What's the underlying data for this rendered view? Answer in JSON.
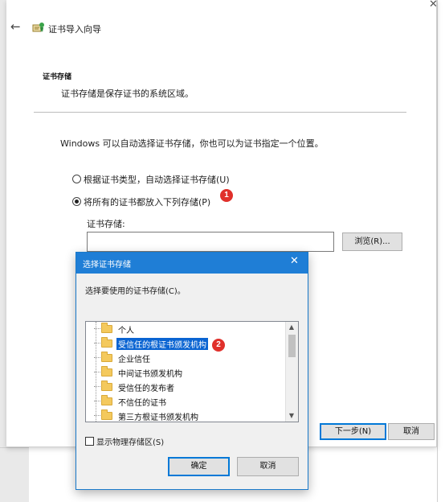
{
  "wizard": {
    "title": "证书导入向导",
    "section_title": "证书存储",
    "section_desc": "证书存储是保存证书的系统区域。",
    "intro": "Windows 可以自动选择证书存储，你也可以为证书指定一个位置。",
    "radio_auto": "根据证书类型，自动选择证书存储(U)",
    "radio_manual": "将所有的证书都放入下列存储(P)",
    "radio_selected": "manual",
    "store_label": "证书存储:",
    "store_value": "",
    "browse_label": "浏览(R)...",
    "next_label": "下一步(N)",
    "cancel_label": "取消",
    "badge_1": "1"
  },
  "dialog": {
    "title": "选择证书存储",
    "instruction": "选择要使用的证书存储(C)。",
    "items": [
      {
        "label": "个人",
        "selected": false
      },
      {
        "label": "受信任的根证书颁发机构",
        "selected": true
      },
      {
        "label": "企业信任",
        "selected": false
      },
      {
        "label": "中间证书颁发机构",
        "selected": false
      },
      {
        "label": "受信任的发布者",
        "selected": false
      },
      {
        "label": "不信任的证书",
        "selected": false
      },
      {
        "label": "第三方根证书颁发机构",
        "selected": false
      }
    ],
    "badge_2": "2",
    "show_physical_label": "显示物理存储区(S)",
    "show_physical_checked": false,
    "ok_label": "确定",
    "cancel_label": "取消"
  },
  "colors": {
    "accent": "#1f7ed6",
    "selection": "#0a64d2",
    "badge": "#e0302b"
  },
  "icons": {
    "back": "back-arrow-icon",
    "wizard": "certificate-icon",
    "close": "close-icon",
    "folder": "folder-icon"
  }
}
